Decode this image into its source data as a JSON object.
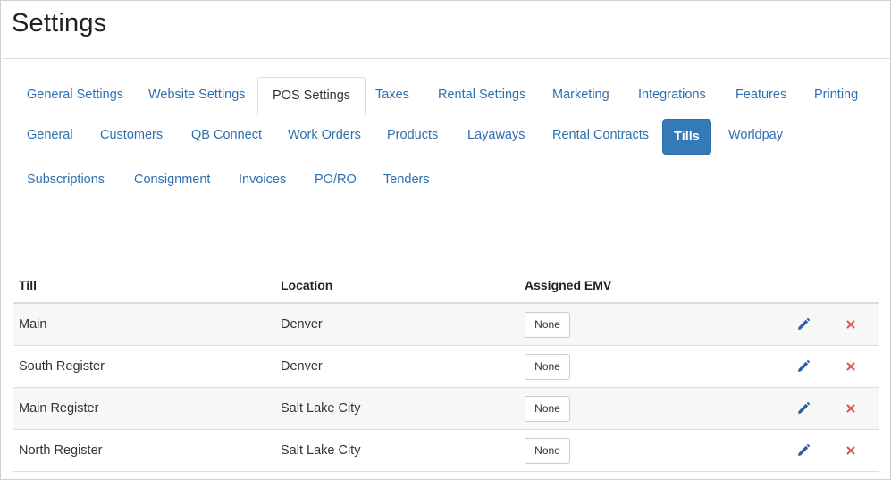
{
  "page": {
    "title": "Settings"
  },
  "primary_tabs": [
    {
      "label": "General Settings",
      "active": false
    },
    {
      "label": "Website Settings",
      "active": false
    },
    {
      "label": "POS Settings",
      "active": true
    },
    {
      "label": "Taxes",
      "active": false
    },
    {
      "label": "Rental Settings",
      "active": false
    },
    {
      "label": "Marketing",
      "active": false
    },
    {
      "label": "Integrations",
      "active": false
    },
    {
      "label": "Features",
      "active": false
    },
    {
      "label": "Printing",
      "active": false
    }
  ],
  "sub_tabs": [
    {
      "label": "General",
      "active": false
    },
    {
      "label": "Customers",
      "active": false
    },
    {
      "label": "QB Connect",
      "active": false
    },
    {
      "label": "Work Orders",
      "active": false
    },
    {
      "label": "Products",
      "active": false
    },
    {
      "label": "Layaways",
      "active": false
    },
    {
      "label": "Rental Contracts",
      "active": false
    },
    {
      "label": "Tills",
      "active": true
    },
    {
      "label": "Worldpay",
      "active": false
    },
    {
      "label": "Subscriptions",
      "active": false
    },
    {
      "label": "Consignment",
      "active": false
    },
    {
      "label": "Invoices",
      "active": false
    },
    {
      "label": "PO/RO",
      "active": false
    },
    {
      "label": "Tenders",
      "active": false
    }
  ],
  "table": {
    "headers": {
      "till": "Till",
      "location": "Location",
      "emv": "Assigned EMV"
    },
    "rows": [
      {
        "till": "Main",
        "location": "Denver",
        "emv": "None"
      },
      {
        "till": "South Register",
        "location": "Denver",
        "emv": "None"
      },
      {
        "till": "Main Register",
        "location": "Salt Lake City",
        "emv": "None"
      },
      {
        "till": "North Register",
        "location": "Salt Lake City",
        "emv": "None"
      }
    ]
  },
  "icons": {
    "edit": "pencil-icon",
    "delete": "close-icon"
  },
  "colors": {
    "link": "#2f6fae",
    "active_pill": "#337ab7",
    "delete": "#d9534f",
    "edit": "#2a5fa8"
  }
}
